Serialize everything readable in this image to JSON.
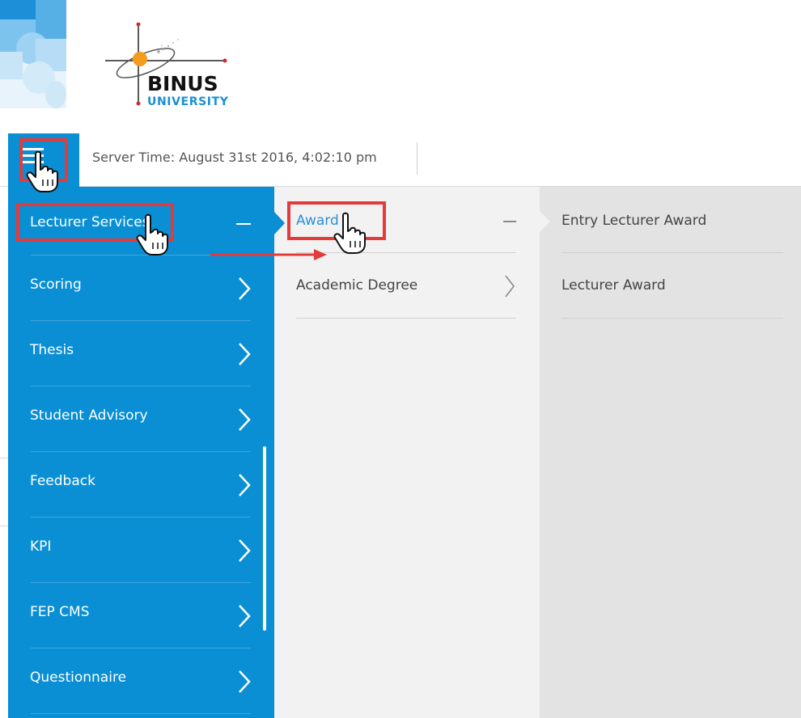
{
  "logo": {
    "name": "BINUS",
    "subtitle": "UNIVERSITY",
    "icon": "binus-crosshair-logo"
  },
  "header": {
    "server_time": "Server Time: August 31st 2016, 4:02:10 pm",
    "menu_icon": "hamburger-menu-icon"
  },
  "colors": {
    "primary": "#0a8fd4",
    "highlight": "#e53a3a",
    "active_link": "#2b8fd6",
    "column2_bg": "#f2f2f2",
    "column3_bg": "#e3e3e3"
  },
  "menu": {
    "level1": [
      {
        "label": "Lecturer Services",
        "icon": "minus-icon",
        "expanded": true
      },
      {
        "label": "Scoring",
        "icon": "chevron-right-icon"
      },
      {
        "label": "Thesis",
        "icon": "chevron-right-icon"
      },
      {
        "label": "Student Advisory",
        "icon": "chevron-right-icon"
      },
      {
        "label": "Feedback",
        "icon": "chevron-right-icon"
      },
      {
        "label": "KPI",
        "icon": "chevron-right-icon"
      },
      {
        "label": "FEP CMS",
        "icon": "chevron-right-icon"
      },
      {
        "label": "Questionnaire",
        "icon": "chevron-right-icon"
      }
    ],
    "level2": [
      {
        "label": "Award",
        "icon": "minus-icon",
        "active": true
      },
      {
        "label": "Academic Degree",
        "icon": "chevron-right-icon"
      }
    ],
    "level3": [
      {
        "label": "Entry Lecturer Award"
      },
      {
        "label": "Lecturer Award"
      }
    ]
  },
  "annotations": {
    "cursor_icon": "hand-pointer-icon",
    "arrow_icon": "arrow-right-icon"
  }
}
